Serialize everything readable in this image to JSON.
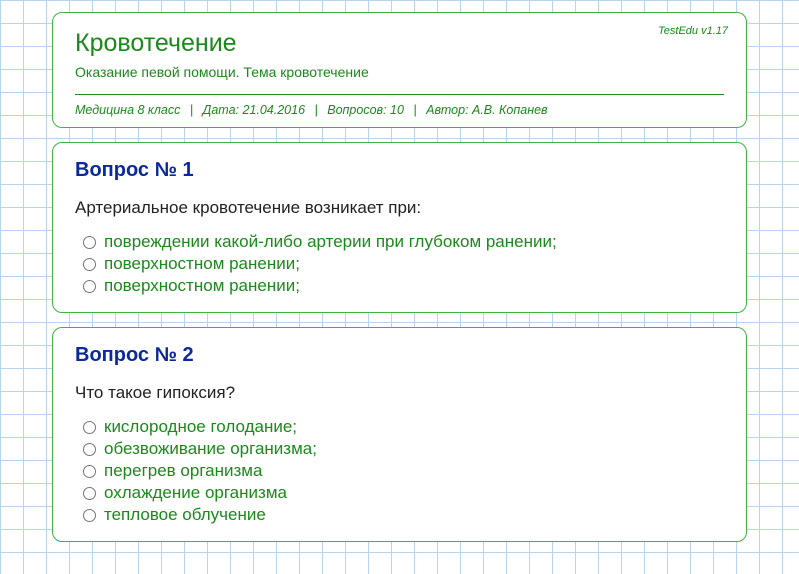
{
  "header": {
    "version": "TestEdu v1.17",
    "title": "Кровотечение",
    "subtitle": "Оказание певой помощи. Тема кровотечение",
    "meta": {
      "subject": "Медицина 8 класс",
      "date_label": "Дата: 21.04.2016",
      "count_label": "Вопросов: 10",
      "author_label": "Автор: А.В. Копанев"
    }
  },
  "questions": [
    {
      "title": "Вопрос № 1",
      "text": "Артериальное кровотечение возникает при:",
      "options": [
        "повреждении какой-либо артерии при глубоком ранении;",
        "поверхностном ранении;",
        "поверхностном ранении;"
      ]
    },
    {
      "title": "Вопрос № 2",
      "text": "Что такое гипоксия?",
      "options": [
        "кислородное голодание;",
        "обезвоживание организма;",
        "перегрев организма",
        "охлаждение организма",
        "тепловое облучение"
      ]
    }
  ]
}
